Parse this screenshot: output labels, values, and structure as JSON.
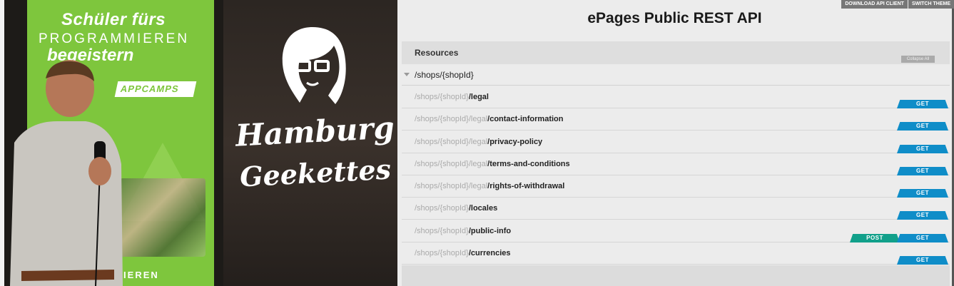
{
  "photo": {
    "banner_line1": "Schüler fürs",
    "banner_line2": "PROGRAMMIEREN",
    "banner_line3": "begeistern",
    "banner_badge": "APPCAMPS",
    "banner_bottom": "AMMIEREN",
    "brand_line1": "Hamburg",
    "brand_line2": "Geekettes"
  },
  "api": {
    "top_buttons": [
      "DOWNLOAD API CLIENT",
      "SWITCH THEME"
    ],
    "title": "ePages Public REST API",
    "resources_label": "Resources",
    "collapse_label": "Collapse All",
    "group_path": "/shops/{shopId}",
    "endpoints": [
      {
        "prefix": "/shops/{shopId}",
        "suffix": "/legal",
        "methods": [
          "GET"
        ]
      },
      {
        "prefix": "/shops/{shopId}/legal",
        "suffix": "/contact-information",
        "methods": [
          "GET"
        ]
      },
      {
        "prefix": "/shops/{shopId}/legal",
        "suffix": "/privacy-policy",
        "methods": [
          "GET"
        ]
      },
      {
        "prefix": "/shops/{shopId}/legal",
        "suffix": "/terms-and-conditions",
        "methods": [
          "GET"
        ]
      },
      {
        "prefix": "/shops/{shopId}/legal",
        "suffix": "/rights-of-withdrawal",
        "methods": [
          "GET"
        ]
      },
      {
        "prefix": "/shops/{shopId}",
        "suffix": "/locales",
        "methods": [
          "GET"
        ]
      },
      {
        "prefix": "/shops/{shopId}",
        "suffix": "/public-info",
        "methods": [
          "POST",
          "GET"
        ]
      },
      {
        "prefix": "/shops/{shopId}",
        "suffix": "/currencies",
        "methods": [
          "GET"
        ]
      }
    ],
    "colors": {
      "get": "#0f8dc8",
      "post": "#11a08a"
    }
  }
}
